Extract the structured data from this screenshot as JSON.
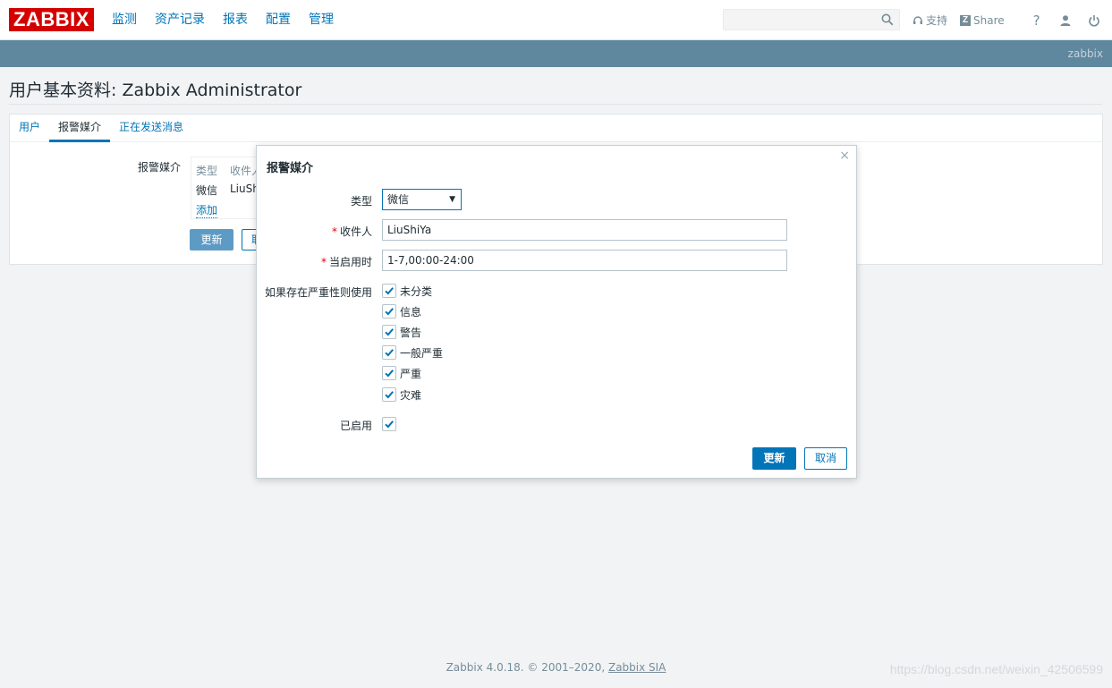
{
  "topnav": {
    "logo": "ZABBIX",
    "menu": [
      "监测",
      "资产记录",
      "报表",
      "配置",
      "管理"
    ],
    "search_value": "",
    "support_label": "支持",
    "share_label": "Share",
    "help_label": "?"
  },
  "serverbar": {
    "server_name": "zabbix"
  },
  "page": {
    "title": "用户基本资料: Zabbix Administrator"
  },
  "tabs": [
    "用户",
    "报警媒介",
    "正在发送消息"
  ],
  "media_tab": {
    "label": "报警媒介",
    "table_headers": [
      "类型",
      "收件人"
    ],
    "row": [
      "微信",
      "LiuSh"
    ],
    "add_link": "添加",
    "update_button": "更新",
    "cancel_button": "取消"
  },
  "modal": {
    "title": "报警媒介",
    "close": "×",
    "type_label": "类型",
    "type_value": "微信",
    "sendto_label": "收件人",
    "sendto_value": "LiuShiYa",
    "period_label": "当启用时",
    "period_value": "1-7,00:00-24:00",
    "severity_label": "如果存在严重性则使用",
    "severities": [
      "未分类",
      "信息",
      "警告",
      "一般严重",
      "严重",
      "灾难"
    ],
    "enabled_label": "已启用",
    "update_button": "更新",
    "cancel_button": "取消"
  },
  "footer": {
    "text": "Zabbix 4.0.18. © 2001–2020, ",
    "link": "Zabbix SIA"
  },
  "watermark": "https://blog.csdn.net/weixin_42506599",
  "colors": {
    "brand_red": "#d40000",
    "link_blue": "#0275b8",
    "server_bar": "#5f889f"
  }
}
